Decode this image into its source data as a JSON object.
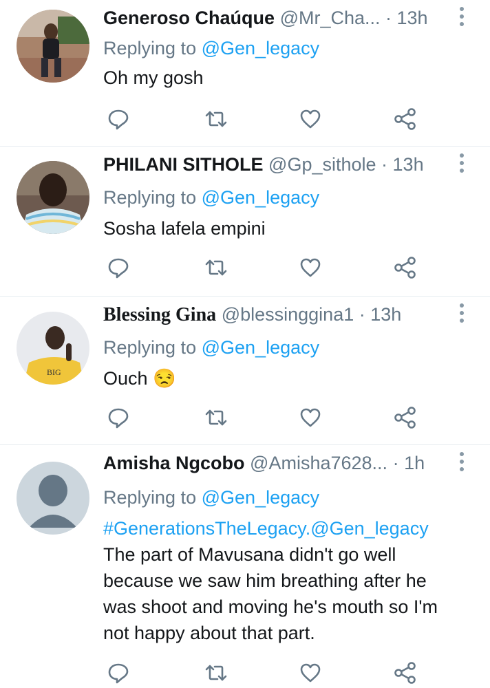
{
  "accent_color": "#1da1f2",
  "muted_color": "#657786",
  "tweets": [
    {
      "name": "Generoso Chaúque",
      "handle": "@Mr_Cha...",
      "time": "· 13h",
      "replying_prefix": "Replying to",
      "replying_to": "@Gen_legacy",
      "text": "Oh my gosh",
      "avatar_icon": "photo-avatar"
    },
    {
      "name": "PHILANI SITHOLE",
      "handle": "@Gp_sithole",
      "time": "· 13h",
      "replying_prefix": "Replying to",
      "replying_to": "@Gen_legacy",
      "text": "Sosha lafela empini",
      "avatar_icon": "photo-avatar"
    },
    {
      "name": "Blessing Gina",
      "handle": "@blessinggina1",
      "time": "· 13h",
      "replying_prefix": "Replying to",
      "replying_to": "@Gen_legacy",
      "text": "Ouch",
      "emoji": "😒",
      "avatar_icon": "photo-avatar"
    },
    {
      "name": "Amisha Ngcobo",
      "handle": "@Amisha7628...",
      "time": "· 1h",
      "replying_prefix": "Replying to",
      "replying_to": "@Gen_legacy",
      "hashtag_line": "#GenerationsTheLegacy.@Gen_legacy",
      "text_lines": [
        "The part of Mavusana didn't go well",
        "because we saw him breathing after he",
        "was shoot and moving he's mouth so I'm",
        "not happy about that part."
      ],
      "avatar_icon": "default-avatar"
    }
  ],
  "action_icons": [
    "reply-icon",
    "retweet-icon",
    "like-icon",
    "share-icon"
  ]
}
